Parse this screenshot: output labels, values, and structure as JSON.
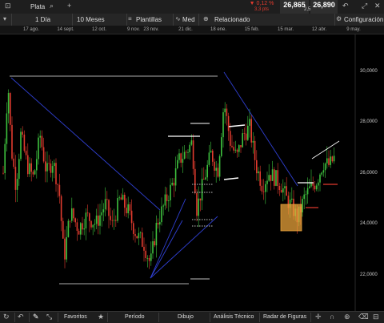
{
  "instrument": {
    "name": "Plata"
  },
  "quote": {
    "change_pct": "▼ 0,12 %",
    "change_pts": "3,3 pts",
    "sell": "26,865",
    "buy": "26,890",
    "spread": "2,5"
  },
  "toolbar": {
    "interval": "1 Día",
    "range": "10 Meses",
    "templates": "Plantillas",
    "indicator": "Med",
    "related": "Relacionado",
    "settings": "Configuración"
  },
  "date_axis": [
    "17 ago.",
    "14 sept.",
    "12 oct.",
    "9 nov.",
    "23 nov.",
    "21 dic.",
    "18 ene.",
    "15 feb.",
    "15 mar.",
    "12 abr.",
    "9 may."
  ],
  "price_axis": [
    "30,0000",
    "28,0000",
    "26,0000",
    "24,0000",
    "22,0000"
  ],
  "bottom": {
    "favorites": "Favoritos",
    "period": "Período",
    "drawing": "Dibujo",
    "technical": "Análisis Técnico",
    "patterns": "Radar de Figuras"
  },
  "colors": {
    "up": "#3ec13e",
    "down": "#e23b2e",
    "trendline": "#2f3fd0",
    "highlight": "#e8a23a"
  },
  "icons": [
    "chart-type-icon",
    "search-icon",
    "add-icon",
    "dropdown-icon",
    "templates-icon",
    "average-icon",
    "related-icon",
    "gear-icon",
    "expand-icon",
    "undo-icon",
    "pencil-icon",
    "tools-icon",
    "star-icon",
    "crosshair-icon",
    "magnet-icon",
    "zoom-icon",
    "delete-icon",
    "lock-icon"
  ],
  "chart_data": {
    "type": "candlestick",
    "x_range": [
      "2020-08-03",
      "2021-05-14"
    ],
    "ylim": [
      21.0,
      31.0
    ],
    "grid": false
  }
}
